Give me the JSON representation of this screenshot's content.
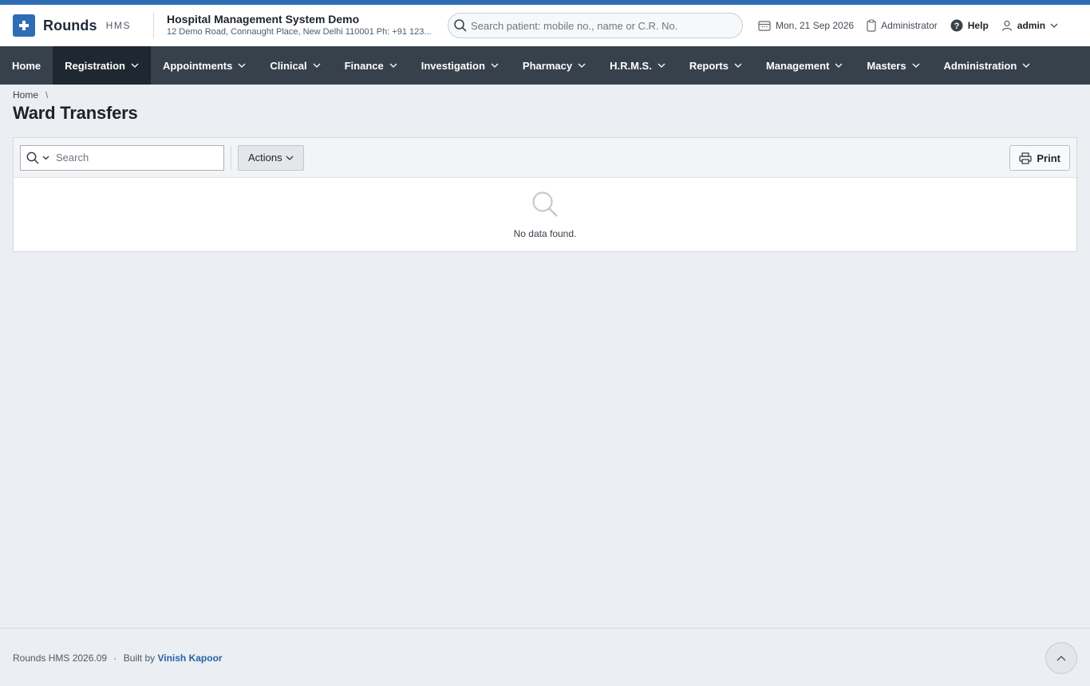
{
  "brand": {
    "name": "Rounds",
    "sub": "HMS"
  },
  "hospital": {
    "name": "Hospital Management System Demo",
    "address": "12 Demo Road, Connaught Place, New Delhi 110001 Ph: +91 123..."
  },
  "patient_search": {
    "placeholder": "Search patient: mobile no., name or C.R. No."
  },
  "header_right": {
    "date": "Mon, 21 Sep 2026",
    "role": "Administrator",
    "help": "Help",
    "user": "admin"
  },
  "nav": {
    "items": [
      {
        "label": "Home"
      },
      {
        "label": "Registration"
      },
      {
        "label": "Appointments"
      },
      {
        "label": "Clinical"
      },
      {
        "label": "Finance"
      },
      {
        "label": "Investigation"
      },
      {
        "label": "Pharmacy"
      },
      {
        "label": "H.R.M.S."
      },
      {
        "label": "Reports"
      },
      {
        "label": "Management"
      },
      {
        "label": "Masters"
      },
      {
        "label": "Administration"
      }
    ]
  },
  "breadcrumb": {
    "home": "Home",
    "separator": "\\"
  },
  "page": {
    "title": "Ward Transfers"
  },
  "toolbar": {
    "search_placeholder": "Search",
    "actions_label": "Actions",
    "print_label": "Print"
  },
  "empty_state": {
    "message": "No data found."
  },
  "footer": {
    "version": "Rounds HMS 2026.09",
    "separator": "·",
    "built_by": "Built by",
    "author": "Vinish Kapoor"
  },
  "colors": {
    "accent": "#2e6db4",
    "navbar": "#36414c",
    "navbar_active": "#1f2730",
    "link": "#2563a8"
  }
}
